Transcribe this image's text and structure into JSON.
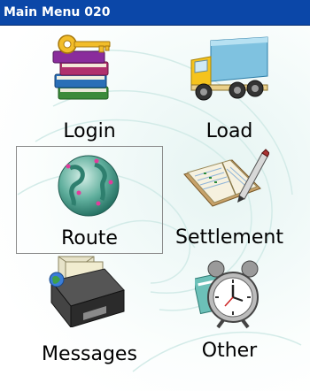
{
  "window": {
    "title": "Main Menu 020"
  },
  "menu": {
    "items": [
      {
        "label": "Login",
        "icon": "books-key-icon"
      },
      {
        "label": "Load",
        "icon": "delivery-truck-icon"
      },
      {
        "label": "Route",
        "icon": "globe-icon",
        "selected": true
      },
      {
        "label": "Settlement",
        "icon": "ledger-pen-icon"
      },
      {
        "label": "Messages",
        "icon": "mail-tray-icon"
      },
      {
        "label": "Other",
        "icon": "alarm-clock-icon"
      }
    ]
  },
  "colors": {
    "titlebar": "#0b47a8",
    "selection_border": "#8a8a8a"
  }
}
